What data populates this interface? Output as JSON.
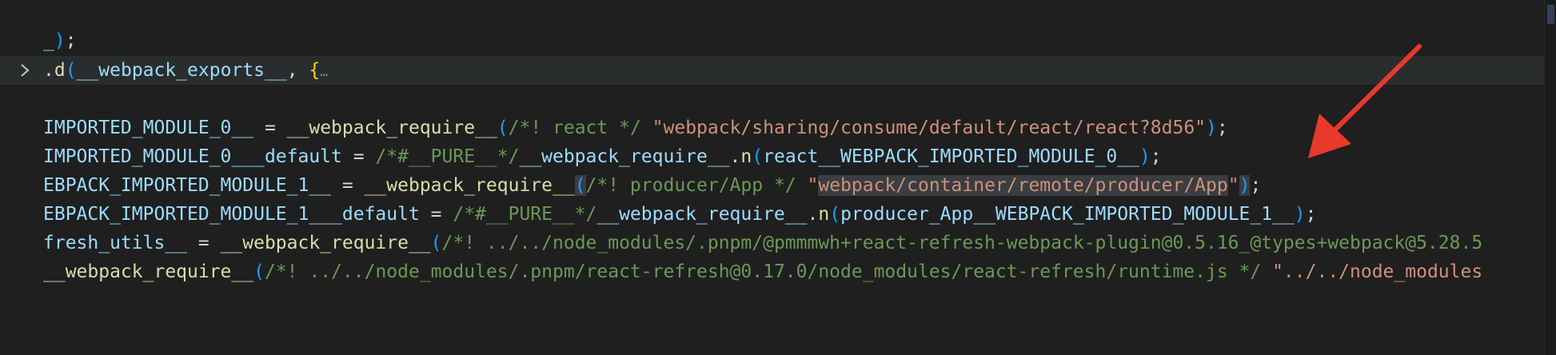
{
  "editor": {
    "lines": [
      {
        "segments": [
          {
            "t": "_",
            "c": "var"
          },
          {
            "t": ")",
            "c": "paren"
          },
          {
            "t": ";",
            "c": "plain"
          }
        ]
      },
      {
        "segments": [
          {
            "t": ".",
            "c": "plain"
          },
          {
            "t": "d",
            "c": "func"
          },
          {
            "t": "(",
            "c": "paren"
          },
          {
            "t": "__webpack_exports__",
            "c": "var"
          },
          {
            "t": ", ",
            "c": "plain"
          },
          {
            "t": "{",
            "c": "brace"
          },
          {
            "t": "…",
            "c": "ellipsis"
          }
        ]
      },
      {
        "segments": []
      },
      {
        "segments": [
          {
            "t": "IMPORTED_MODULE_0__",
            "c": "var"
          },
          {
            "t": " = ",
            "c": "plain"
          },
          {
            "t": "__webpack_require__",
            "c": "func"
          },
          {
            "t": "(",
            "c": "paren"
          },
          {
            "t": "/*! react */",
            "c": "comment"
          },
          {
            "t": " ",
            "c": "plain"
          },
          {
            "t": "\"webpack/sharing/consume/default/react/react?8d56\"",
            "c": "string"
          },
          {
            "t": ")",
            "c": "paren"
          },
          {
            "t": ";",
            "c": "plain"
          }
        ]
      },
      {
        "segments": [
          {
            "t": "IMPORTED_MODULE_0___default",
            "c": "var"
          },
          {
            "t": " = ",
            "c": "plain"
          },
          {
            "t": "/*#__PURE__*/",
            "c": "comment"
          },
          {
            "t": "__webpack_require__",
            "c": "var"
          },
          {
            "t": ".",
            "c": "plain"
          },
          {
            "t": "n",
            "c": "func"
          },
          {
            "t": "(",
            "c": "paren"
          },
          {
            "t": "react__WEBPACK_IMPORTED_MODULE_0__",
            "c": "var"
          },
          {
            "t": ")",
            "c": "paren"
          },
          {
            "t": ";",
            "c": "plain"
          }
        ]
      },
      {
        "segments": [
          {
            "t": "EBPACK_IMPORTED_MODULE_1__",
            "c": "var"
          },
          {
            "t": " = ",
            "c": "plain"
          },
          {
            "t": "__webpack_require__",
            "c": "func"
          },
          {
            "t": "(",
            "c": "paren",
            "sel": true
          },
          {
            "t": "/*! producer/App */",
            "c": "comment"
          },
          {
            "t": " \"",
            "c": "string"
          },
          {
            "t": "webpack/container/remote/producer/App",
            "c": "string",
            "sel": true
          },
          {
            "t": "\"",
            "c": "string"
          },
          {
            "t": ")",
            "c": "paren",
            "sel": true
          },
          {
            "t": ";",
            "c": "plain"
          }
        ]
      },
      {
        "segments": [
          {
            "t": "EBPACK_IMPORTED_MODULE_1___default",
            "c": "var"
          },
          {
            "t": " = ",
            "c": "plain"
          },
          {
            "t": "/*#__PURE__*/",
            "c": "comment"
          },
          {
            "t": "__webpack_require__",
            "c": "var"
          },
          {
            "t": ".",
            "c": "plain"
          },
          {
            "t": "n",
            "c": "func"
          },
          {
            "t": "(",
            "c": "paren"
          },
          {
            "t": "producer_App__WEBPACK_IMPORTED_MODULE_1__",
            "c": "var"
          },
          {
            "t": ")",
            "c": "paren"
          },
          {
            "t": ";",
            "c": "plain"
          }
        ]
      },
      {
        "segments": [
          {
            "t": "fresh_utils__",
            "c": "var"
          },
          {
            "t": " = ",
            "c": "plain"
          },
          {
            "t": "__webpack_require__",
            "c": "func"
          },
          {
            "t": "(",
            "c": "paren"
          },
          {
            "t": "/*! ../../node_modules/.pnpm/@pmmmwh+react-refresh-webpack-plugin@0.5.16_@types+webpack@5.28.5",
            "c": "comment"
          }
        ]
      },
      {
        "segments": [
          {
            "t": "__webpack_require__",
            "c": "func"
          },
          {
            "t": "(",
            "c": "paren"
          },
          {
            "t": "/*! ../../node_modules/.pnpm/react-refresh@0.17.0/node_modules/react-refresh/runtime.js */",
            "c": "comment"
          },
          {
            "t": " ",
            "c": "plain"
          },
          {
            "t": "\"../../node_modules",
            "c": "string"
          }
        ]
      }
    ]
  },
  "colors": {
    "background": "#1f1f1f",
    "arrow": "#e8392b"
  },
  "icons": {
    "fold": "chevron-right-icon"
  }
}
